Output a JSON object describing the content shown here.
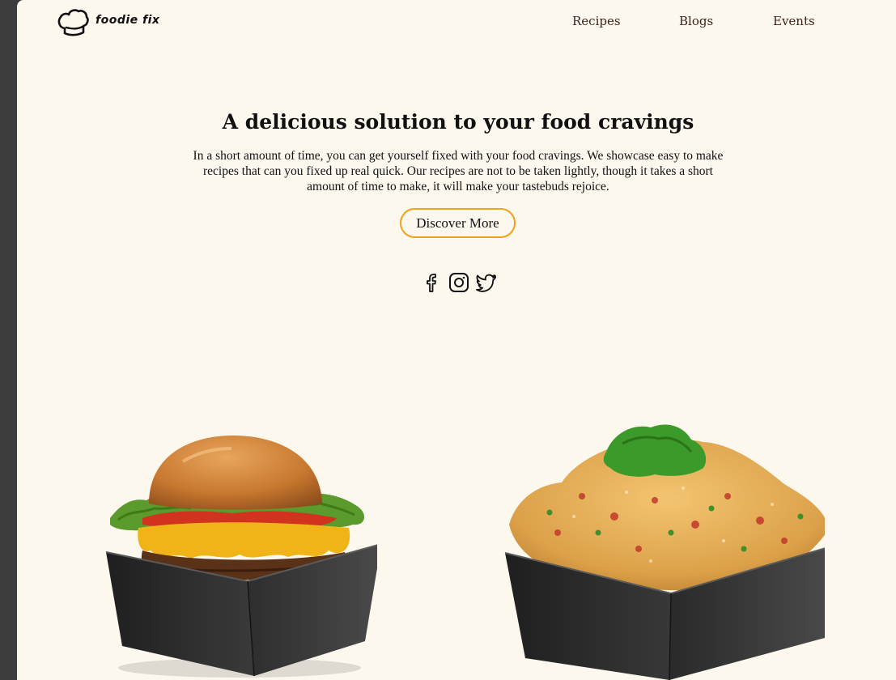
{
  "header": {
    "logo_text": "foodie fix",
    "nav": {
      "recipes": "Recipes",
      "blogs": "Blogs",
      "events": "Events"
    }
  },
  "hero": {
    "title": "A delicious solution to your food cravings",
    "description": "In a short amount of time, you can get yourself fixed with your food cravings. We showcase easy to make recipes that can you fixed up real quick. Our recipes are not to be taken lightly, though it takes a short amount of time to make, it will make your tastebuds rejoice.",
    "cta_label": "Discover More"
  },
  "social": [
    "facebook-icon",
    "instagram-icon",
    "twitter-icon"
  ],
  "colors": {
    "background": "#fdf8ee",
    "accent": "#f0a21a",
    "nav_text": "#3a1f1a",
    "box": "#2b2b2b"
  },
  "images": [
    "burger-in-box",
    "fried-rice-in-box"
  ]
}
